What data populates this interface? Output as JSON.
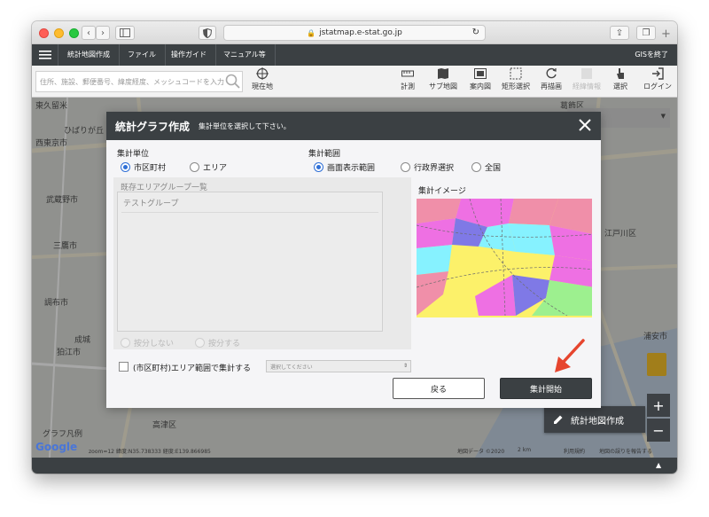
{
  "browser": {
    "url": "jstatmap.e-stat.go.jp"
  },
  "menu": {
    "items": [
      "統計地図作成",
      "ファイル",
      "操作ガイド",
      "マニュアル等"
    ],
    "exit_label": "GISを終了"
  },
  "toolbar": {
    "search_placeholder": "住所、施設、郵便番号、緯度経度、メッシュコードを入力",
    "current_location": "現在地",
    "tools": [
      "計測",
      "サブ地図",
      "案内図",
      "矩形選択",
      "再描画",
      "経緯情報",
      "選択",
      "ログイン"
    ]
  },
  "map": {
    "labels": [
      {
        "text": "東久留米",
        "name": "place-label-higashikurume"
      },
      {
        "text": "西東京市",
        "name": "place-label-nishitokyo"
      },
      {
        "text": "ひばりが丘",
        "name": "place-label-hibarigaoka"
      },
      {
        "text": "武蔵野市",
        "name": "place-label-musashino"
      },
      {
        "text": "三鷹市",
        "name": "place-label-mitaka"
      },
      {
        "text": "調布市",
        "name": "place-label-chofu"
      },
      {
        "text": "狛江市",
        "name": "place-label-komae"
      },
      {
        "text": "成城",
        "name": "place-label-seijo"
      },
      {
        "text": "葛飾区",
        "name": "place-label-katsushika"
      },
      {
        "text": "江戸川区",
        "name": "place-label-edogawa"
      },
      {
        "text": "浦安市",
        "name": "place-label-urayasu"
      },
      {
        "text": "高津区",
        "name": "place-label-takatsu"
      },
      {
        "text": "グラフ凡例",
        "name": "graph-legend-label"
      }
    ],
    "map_type": "Map",
    "footer_left": "zoom=12 緯度:N35.738333 経度:E139.866985",
    "footer_data": "地図データ ©2020",
    "footer_scale": "2 km",
    "footer_terms": "利用規約",
    "footer_report": "地図の誤りを報告する",
    "google": "Google"
  },
  "dialog": {
    "title": "統計グラフ作成",
    "subtitle": "集計単位を選択して下さい。",
    "unit_label": "集計単位",
    "unit_options": [
      "市区町村",
      "エリア"
    ],
    "range_label": "集計範囲",
    "range_options": [
      "画面表示範囲",
      "行政界選択",
      "全国"
    ],
    "group_list_title": "既存エリアグループ一覧",
    "group_items": [
      "テストグループ"
    ],
    "split_options": [
      "按分しない",
      "按分する"
    ],
    "area_checkbox_label": "(市区町村)エリア範囲で集計する",
    "area_select_placeholder": "選択してください",
    "preview_title": "集計イメージ",
    "back_button": "戻る",
    "start_button": "集計開始"
  },
  "create_map_button": "統計地図作成",
  "colors": {
    "header": "#3b4043",
    "accent_radio": "#2f6fd6",
    "arrow": "#e6452e"
  }
}
